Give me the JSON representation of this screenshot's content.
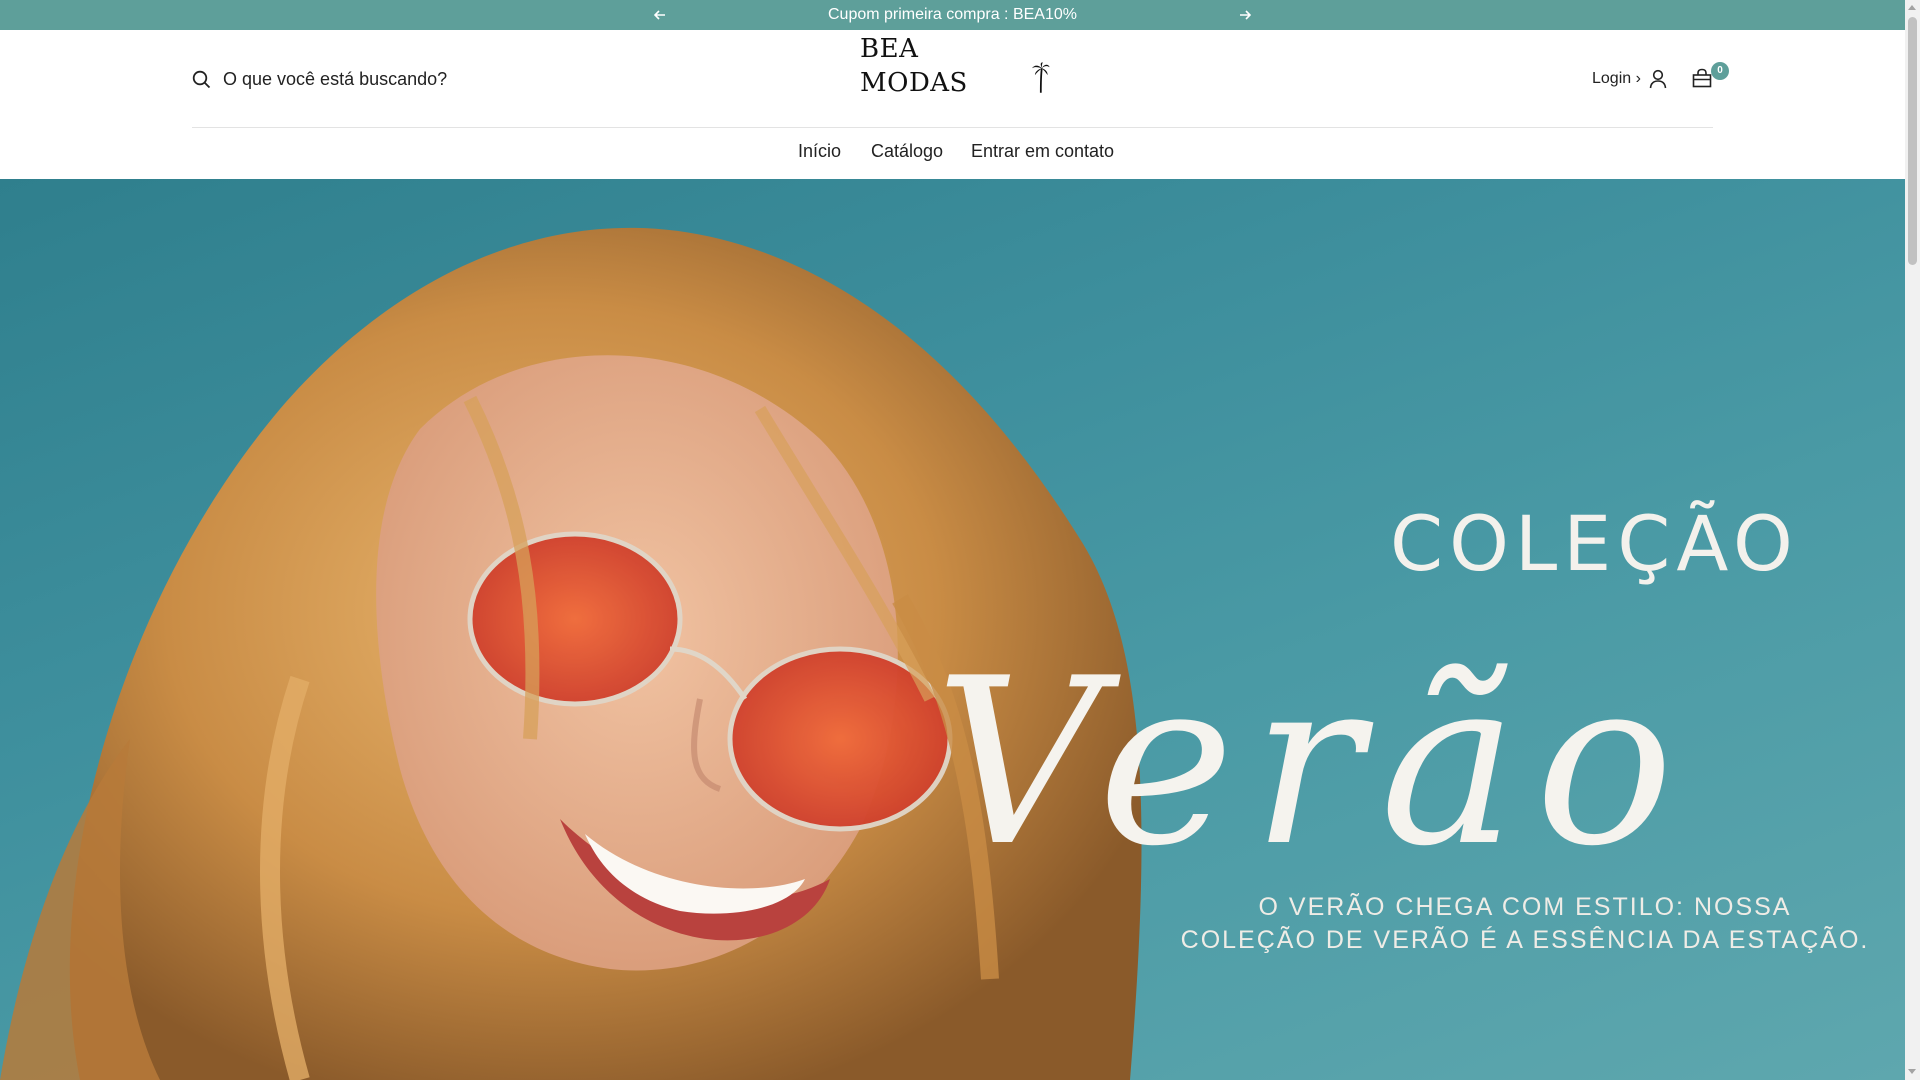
{
  "announcement": {
    "message": "Cupom primeira compra : BEA10%",
    "prev_icon": "arrow-left-icon",
    "next_icon": "arrow-right-icon"
  },
  "header": {
    "search_placeholder": "O que você está buscando?",
    "logo_text": "BEA MODAS",
    "login_label": "Login ›",
    "cart_count": "0"
  },
  "nav": {
    "items": [
      {
        "label": "Início"
      },
      {
        "label": "Catálogo"
      },
      {
        "label": "Entrar em contato"
      }
    ]
  },
  "hero": {
    "title": "COLEÇÃO",
    "script_title": "Verão",
    "tagline_line1": "O VERÃO CHEGA COM ESTILO: NOSSA",
    "tagline_line2": "COLEÇÃO DE VERÃO É A ESSÊNCIA DA ESTAÇÃO."
  },
  "colors": {
    "accent": "#5e9f9a",
    "hero_bg": "#3e8f9d",
    "text": "#1c1c1c"
  }
}
